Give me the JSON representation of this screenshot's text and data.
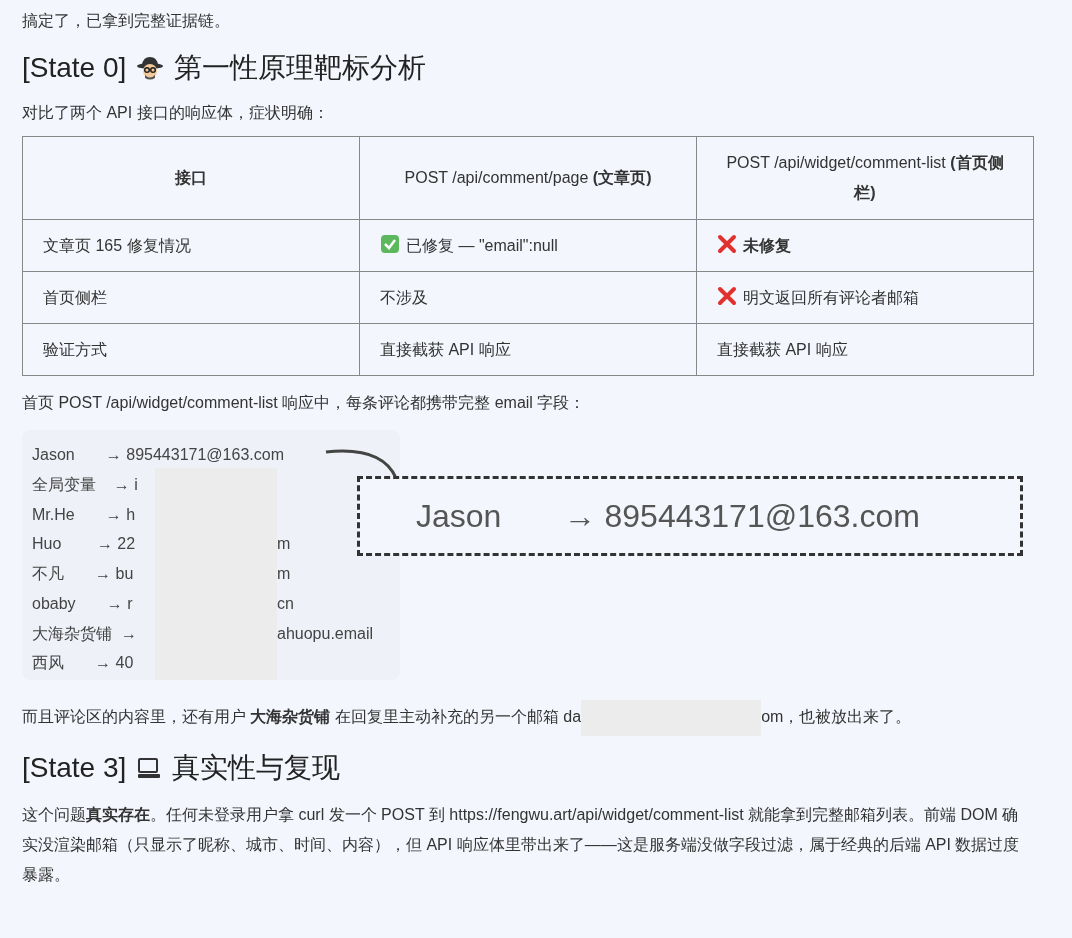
{
  "intro": "搞定了，已拿到完整证据链。",
  "section_1": {
    "title_prefix": "[State 0]",
    "title": "第一性原理靶标分析"
  },
  "lead": "对比了两个 API 接口的响应体，症状明确：",
  "table": {
    "columns": [
      "接口",
      "POST /api/comment/page **(文章页)**",
      "POST /api/widget/comment-list **(首页侧栏)**"
    ],
    "rows": [
      [
        {
          "kind": "plain",
          "text": "文章页 165 修复情况"
        },
        {
          "kind": "check",
          "text": "已修复 — \"email\":null"
        },
        {
          "kind": "cross",
          "text": "**未修复**"
        }
      ],
      [
        {
          "kind": "plain",
          "text": "首页侧栏"
        },
        {
          "kind": "plain",
          "text": "不涉及"
        },
        {
          "kind": "cross",
          "text": "明文返回所有评论者邮箱"
        }
      ],
      [
        {
          "kind": "plain",
          "text": "验证方式"
        },
        {
          "kind": "plain",
          "text": "直接截获 API 响应"
        },
        {
          "kind": "plain",
          "text": "直接截获 API 响应"
        }
      ]
    ]
  },
  "list_intro": "首页 POST /api/widget/comment-list 响应中，每条评论都携带完整 email 字段：",
  "code_lines": [
    {
      "left": "Jason       → 895443171@163.com"
    },
    {
      "left": "全局变量    → i"
    },
    {
      "left": "Mr.He       → h"
    },
    {
      "left": "Huo        → 22",
      "right": "m"
    },
    {
      "left": "不凡       → bu",
      "right": "m"
    },
    {
      "left": "obaby       → r",
      "right": "cn"
    },
    {
      "left": "大海杂货铺  → ",
      "right": "ahuopu.email"
    },
    {
      "left": "西风       → 40"
    }
  ],
  "zoom_callout": "Jason       → 895443171@163.com",
  "note": {
    "before": "而且评论区的内容里，还有用户 **大海杂货铺** 在回复里主动补充的另一个邮箱 da",
    "after": "om，也被放出来了。"
  },
  "section_2": {
    "title_prefix": "[State 3]",
    "title": "真实性与复现"
  },
  "conclusion": "这个问题**真实存在**。任何未登录用户拿 curl 发一个 POST 到 https://fengwu.art/api/widget/comment-list 就能拿到完整邮箱列表。前端 DOM 确实没渲染邮箱（只显示了昵称、城市、时间、内容），但 API 响应体里带出来了——这是服务端没做字段过滤，属于经典的后端 API 数据过度暴露。"
}
